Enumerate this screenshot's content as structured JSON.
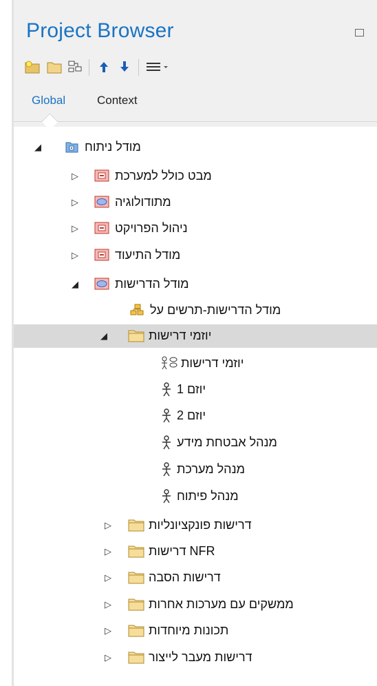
{
  "panel": {
    "title": "Project Browser"
  },
  "toolbar": {
    "icons": [
      "new-model-icon",
      "folder-icon",
      "diagram-icon",
      "move-up-icon",
      "move-down-icon",
      "menu-icon"
    ]
  },
  "tabs": [
    {
      "label": "Global",
      "active": true
    },
    {
      "label": "Context",
      "active": false
    }
  ],
  "tree": [
    {
      "label": "מודל ניתוח",
      "icon": "root-model-icon",
      "toggle": "expanded",
      "selected": false
    },
    {
      "label": "מבט כולל למערכת",
      "icon": "package-view-icon",
      "toggle": "collapsed",
      "selected": false
    },
    {
      "label": "מתודולוגיה",
      "icon": "usecase-view-icon",
      "toggle": "collapsed",
      "selected": false
    },
    {
      "label": "ניהול הפרויקט",
      "icon": "package-view-icon",
      "toggle": "collapsed",
      "selected": false
    },
    {
      "label": "מודל התיעוד",
      "icon": "package-view-icon",
      "toggle": "collapsed",
      "selected": false
    },
    {
      "label": "מודל הדרישות",
      "icon": "usecase-view-icon",
      "toggle": "expanded",
      "selected": false
    },
    {
      "label": "מודל הדרישות-תרשים על",
      "icon": "diagram-icon",
      "toggle": "none",
      "selected": false
    },
    {
      "label": "יוזמי דרישות",
      "icon": "folder-icon",
      "toggle": "expanded",
      "selected": true
    },
    {
      "label": "יוזמי דרישות",
      "icon": "actor-diagram-icon",
      "toggle": "none",
      "selected": false
    },
    {
      "label": "יוזם 1",
      "icon": "actor-icon",
      "toggle": "none",
      "selected": false
    },
    {
      "label": "יוזם 2",
      "icon": "actor-icon",
      "toggle": "none",
      "selected": false
    },
    {
      "label": "מנהל אבטחת מידע",
      "icon": "actor-icon",
      "toggle": "none",
      "selected": false
    },
    {
      "label": "מנהל מערכת",
      "icon": "actor-icon",
      "toggle": "none",
      "selected": false
    },
    {
      "label": "מנהל פיתוח",
      "icon": "actor-icon",
      "toggle": "none",
      "selected": false
    },
    {
      "label": "דרישות פונקציונליות",
      "icon": "folder-icon",
      "toggle": "collapsed",
      "selected": false
    },
    {
      "label": "NFR דרישות",
      "icon": "folder-icon",
      "toggle": "collapsed",
      "selected": false
    },
    {
      "label": "דרישות הסבה",
      "icon": "folder-icon",
      "toggle": "collapsed",
      "selected": false
    },
    {
      "label": "ממשקים עם מערכות  אחרות",
      "icon": "folder-icon",
      "toggle": "collapsed",
      "selected": false
    },
    {
      "label": "תכונות מיוחדות",
      "icon": "folder-icon",
      "toggle": "collapsed",
      "selected": false
    },
    {
      "label": "דרישות מעבר לייצור",
      "icon": "folder-icon",
      "toggle": "collapsed",
      "selected": false
    }
  ]
}
